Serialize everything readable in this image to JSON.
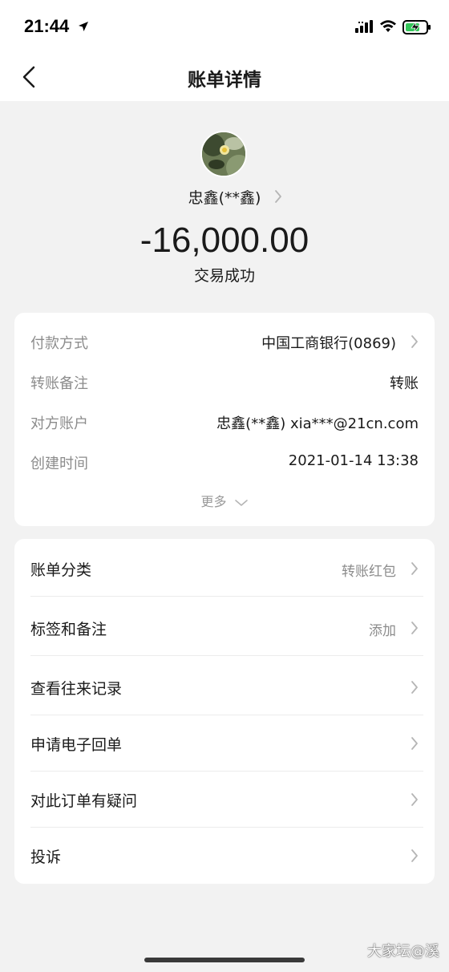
{
  "status_bar": {
    "time": "21:44"
  },
  "nav": {
    "title": "账单详情"
  },
  "header": {
    "payee_name": "忠鑫(**鑫)",
    "amount": "-16,000.00",
    "status": "交易成功"
  },
  "details": {
    "rows": [
      {
        "label": "付款方式",
        "value": "中国工商银行(0869)"
      },
      {
        "label": "转账备注",
        "value": "转账"
      },
      {
        "label": "对方账户",
        "value": "忠鑫(**鑫) xia***@21cn.com"
      },
      {
        "label": "创建时间",
        "value": "2021-01-14 13:38"
      }
    ],
    "more_label": "更多"
  },
  "actions": [
    {
      "label": "账单分类",
      "value": "转账红包"
    },
    {
      "label": "标签和备注",
      "value": "添加"
    },
    {
      "label": "查看往来记录",
      "value": ""
    },
    {
      "label": "申请电子回单",
      "value": ""
    },
    {
      "label": "对此订单有疑问",
      "value": ""
    },
    {
      "label": "投诉",
      "value": ""
    }
  ],
  "watermark": "大家坛@溪",
  "colors": {
    "background": "#f2f2f2",
    "card": "#ffffff",
    "label_gray": "#8c8c8c",
    "text": "#1a1a1a"
  }
}
